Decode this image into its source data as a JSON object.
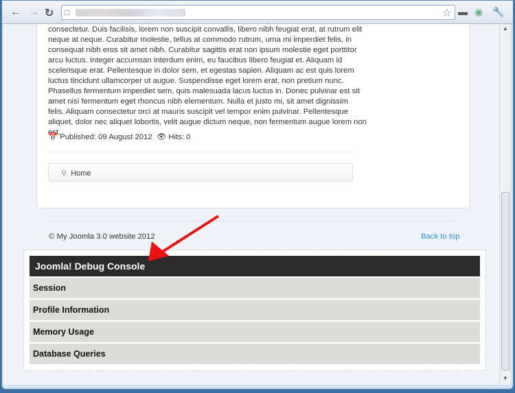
{
  "browser": {
    "back_icon": "arrow-left",
    "forward_icon": "arrow-right",
    "reload_icon": "reload",
    "star_icon": "star",
    "address": ""
  },
  "article": {
    "lines": [
      "consectetur. Duis facilisis, lorem non suscipit convallis, libero nibh feugiat erat, at rutrum elit",
      "neque at neque. Curabitur molestie, tellus at commodo rutrum, urna mi imperdiet felis, in",
      "consequat nibh eros sit amet nibh. Curabitur sagittis erat non ipsum molestie eget porttitor",
      "arcu luctus. Integer accumsan interdum enim, eu faucibus libero feugiat et. Aliquam id",
      "scelerisque erat. Pellentesque in dolor sem, et egestas sapien. Aliquam ac est quis lorem",
      "luctus tincidunt ullamcorper ut augue. Suspendisse eget lorem erat, non pretium nunc.",
      "Phasellus fermentum imperdiet sem, quis malesuada lacus luctus in. Donec pulvinar est sit",
      "amet nisi fermentum eget rhoncus nibh elementum. Nulla et justo mi, sit amet dignissim",
      "felis. Aliquam consectetur orci at mauris suscipit vel tempor enim pulvinar. Pellentesque",
      "aliquet, dolor nec aliquet lobortis, velit augue dictum neque, non fermentum augue lorem non",
      "est."
    ],
    "published": "Published: 09 August 2012",
    "hits": "Hits: 0"
  },
  "breadcrumb": {
    "home": "Home"
  },
  "footer": {
    "copyright": "© My Joomla 3.0 website 2012",
    "back_to_top": "Back to top"
  },
  "debug": {
    "title": "Joomla! Debug Console",
    "sections": [
      "Session",
      "Profile Information",
      "Memory Usage",
      "Database Queries"
    ]
  },
  "colors": {
    "header": "#2b2b2b",
    "row": "#dcdcd8",
    "link": "#2a8fcf",
    "arrow": "#ee1111"
  }
}
